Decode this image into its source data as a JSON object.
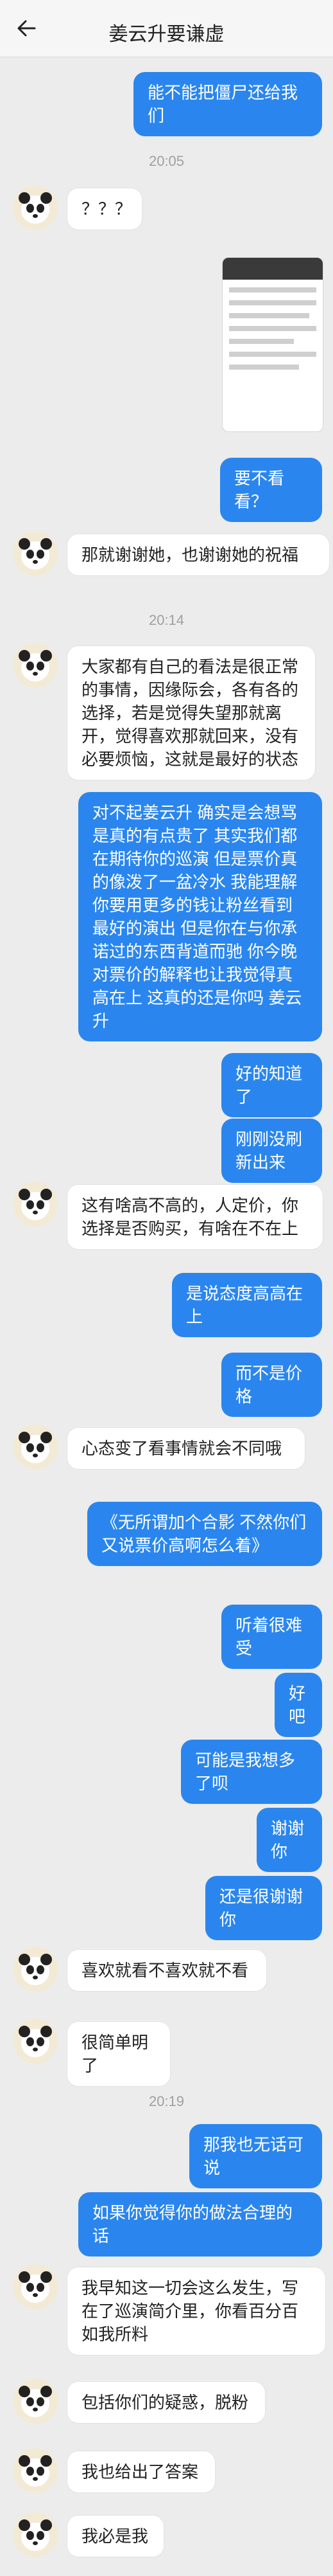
{
  "header": {
    "title": "姜云升要谦虚"
  },
  "icons": {
    "back": "back-arrow-icon",
    "avatar": "panda-avatar-icon"
  },
  "colors": {
    "outgoing_bubble": "#2a86ee",
    "incoming_bubble": "#ffffff",
    "background": "#ececec"
  },
  "messages": {
    "m1": {
      "text": "能不能把僵尸还给我们"
    },
    "ts1": {
      "text": "20:05"
    },
    "m2": {
      "text": "？？？"
    },
    "m4": {
      "text": "要不看看？"
    },
    "m5": {
      "text": "那就谢谢她，也谢谢她的祝福"
    },
    "ts2": {
      "text": "20:14"
    },
    "m6": {
      "text": "大家都有自己的看法是很正常的事情，因缘际会，各有各的选择，若是觉得失望那就离开，觉得喜欢那就回来，没有必要烦恼，这就是最好的状态"
    },
    "m7": {
      "text": "对不起姜云升  确实是会想骂是真的有点贵了  其实我们都在期待你的巡演  但是票价真的像泼了一盆冷水  我能理解你要用更多的钱让粉丝看到最好的演出  但是你在与你承诺过的东西背道而驰  你今晚对票价的解释也让我觉得真高在上  这真的还是你吗  姜云升"
    },
    "m8": {
      "text": "好的知道了"
    },
    "m9": {
      "text": "刚刚没刷新出来"
    },
    "m10": {
      "text": "这有啥高不高的，人定价，你选择是否购买，有啥在不在上"
    },
    "m11": {
      "text": "是说态度高高在上"
    },
    "m12": {
      "text": "而不是价格"
    },
    "m13": {
      "text": "心态变了看事情就会不同哦"
    },
    "m14": {
      "text": "《无所谓加个合影  不然你们又说票价高啊怎么着》"
    },
    "m15": {
      "text": "听着很难受"
    },
    "m16": {
      "text": "好吧"
    },
    "m17": {
      "text": "可能是我想多了呗"
    },
    "m18": {
      "text": "谢谢你"
    },
    "m19": {
      "text": "还是很谢谢你"
    },
    "m20": {
      "text": "喜欢就看不喜欢就不看"
    },
    "m21": {
      "text": "很简单明了"
    },
    "ts3": {
      "text": "20:19"
    },
    "m22": {
      "text": "那我也无话可说"
    },
    "m23": {
      "text": "如果你觉得你的做法合理的话"
    },
    "m24": {
      "text": "我早知这一切会这么发生，写在了巡演简介里，你看百分百如我所料"
    },
    "m25": {
      "text": "包括你们的疑惑，脱粉"
    },
    "m26": {
      "text": "我也给出了答案"
    },
    "m27": {
      "text": "我必是我"
    }
  }
}
